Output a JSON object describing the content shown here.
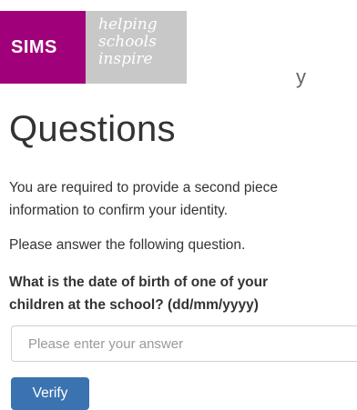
{
  "brand": {
    "name": "SIMS",
    "tagline": [
      "helping",
      "schools",
      "inspire"
    ],
    "colors": {
      "sims_bg": "#a0007a",
      "tagline_bg": "#c8c8c8"
    }
  },
  "header": {
    "partial_text": "y"
  },
  "page": {
    "title": "Questions",
    "intro_lines": [
      "You are required to provide a second piece",
      "information to confirm your identity."
    ],
    "instruction": "Please answer the following question.",
    "question_lines": [
      "What is the date of birth of one of your",
      "children at the school? (dd/mm/yyyy)"
    ]
  },
  "form": {
    "answer": {
      "value": "",
      "placeholder": "Please enter your answer"
    },
    "verify_label": "Verify",
    "accent_color": "#3b73b0"
  }
}
